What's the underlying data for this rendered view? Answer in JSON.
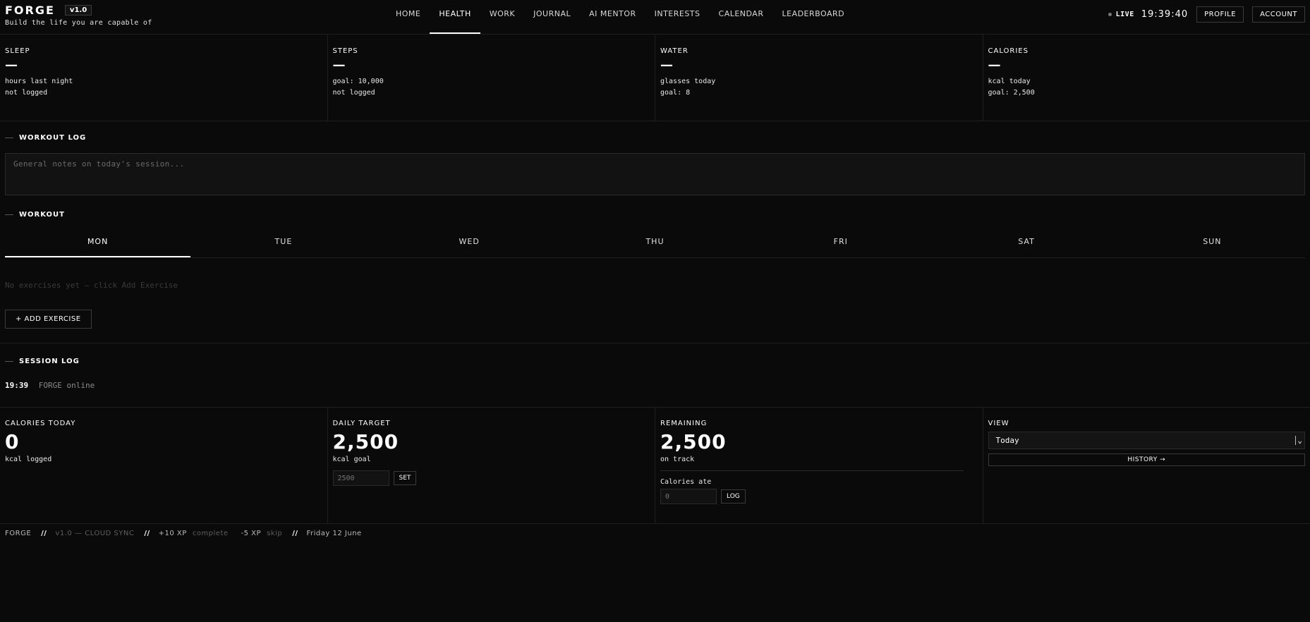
{
  "brand": {
    "name": "FORGE",
    "version": "v1.0",
    "tagline": "Build the life you are capable of"
  },
  "nav": [
    "HOME",
    "HEALTH",
    "WORK",
    "JOURNAL",
    "AI MENTOR",
    "INTERESTS",
    "CALENDAR",
    "LEADERBOARD"
  ],
  "active_nav": "HEALTH",
  "header": {
    "live": "LIVE",
    "clock": "19:39:40",
    "profile": "PROFILE",
    "account": "ACCOUNT"
  },
  "stats": [
    {
      "label": "SLEEP",
      "value": "—",
      "sub1": "hours last night",
      "sub2": "not logged"
    },
    {
      "label": "STEPS",
      "value": "—",
      "sub1": "goal: 10,000",
      "sub2": "not logged"
    },
    {
      "label": "WATER",
      "value": "—",
      "sub1": "glasses today",
      "sub2": "goal: 8"
    },
    {
      "label": "CALORIES",
      "value": "—",
      "sub1": "kcal today",
      "sub2": "goal: 2,500"
    }
  ],
  "workout_log": {
    "title": "WORKOUT LOG",
    "placeholder": "General notes on today's session..."
  },
  "workout": {
    "title": "WORKOUT",
    "days": [
      "MON",
      "TUE",
      "WED",
      "THU",
      "FRI",
      "SAT",
      "SUN"
    ],
    "active_day": "MON",
    "empty": "No exercises yet — click Add Exercise",
    "add_label": "+ ADD EXERCISE"
  },
  "session_log": {
    "title": "SESSION LOG",
    "entries": [
      {
        "time": "19:39",
        "msg": "FORGE online"
      }
    ]
  },
  "calories": {
    "today": {
      "label": "CALORIES TODAY",
      "value": "0",
      "sub": "kcal logged"
    },
    "target": {
      "label": "DAILY TARGET",
      "value": "2,500",
      "sub": "kcal goal",
      "input_value": "2500",
      "btn": "SET"
    },
    "remaining": {
      "label": "REMAINING",
      "value": "2,500",
      "sub": "on track",
      "ate_label": "Calories ate",
      "input_value": "0",
      "btn": "LOG"
    },
    "view": {
      "label": "VIEW",
      "selected": "Today",
      "history": "HISTORY →"
    }
  },
  "footer": {
    "brand": "FORGE",
    "sep": "//",
    "version": "v1.0 — CLOUD SYNC",
    "xp_plus": "+10 XP",
    "complete": "complete",
    "xp_minus": "-5 XP",
    "skip": "skip",
    "date": "Friday 12 June"
  }
}
